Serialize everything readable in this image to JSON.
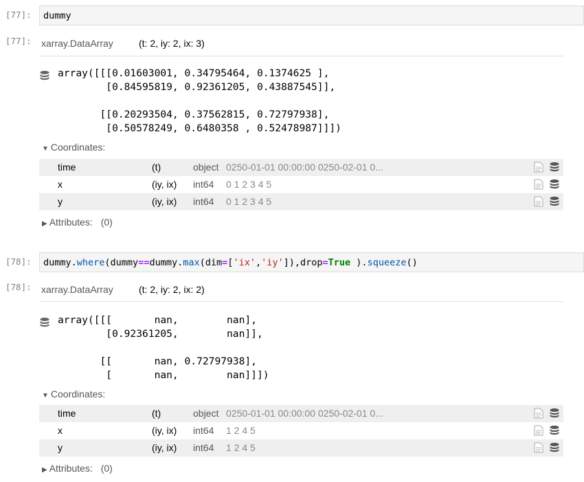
{
  "cells": [
    {
      "input_prompt": "[77]:",
      "output_prompt": "[77]:",
      "code_plain": "dummy",
      "output": {
        "type_label": "xarray.DataArray",
        "dims_label": "(t: 2, iy: 2, ix: 3)",
        "array_text": "array([[[0.01603001, 0.34795464, 0.1374625 ],\n        [0.84595819, 0.92361205, 0.43887545]],\n\n       [[0.20293504, 0.37562815, 0.72797938],\n        [0.50578249, 0.6480358 , 0.52478987]]])",
        "coordinates_label": "Coordinates:",
        "coords": [
          {
            "name": "time",
            "dims": "(t)",
            "dtype": "object",
            "preview": "0250-01-01 00:00:00 0250-02-01 0..."
          },
          {
            "name": "x",
            "dims": "(iy, ix)",
            "dtype": "int64",
            "preview": "0 1 2 3 4 5"
          },
          {
            "name": "y",
            "dims": "(iy, ix)",
            "dtype": "int64",
            "preview": "0 1 2 3 4 5"
          }
        ],
        "attributes_label": "Attributes:",
        "attributes_count": "(0)"
      }
    },
    {
      "input_prompt": "[78]:",
      "output_prompt": "[78]:",
      "code_tokens": {
        "t1": "dummy.",
        "t2": "where",
        "t3": "(dummy",
        "t4": "==",
        "t5": "dummy.",
        "t6": "max",
        "t7": "(dim",
        "t8": "=",
        "t9": "[",
        "t10": "'ix'",
        "t11": ",",
        "t12": "'iy'",
        "t13": "]),drop",
        "t14": "=",
        "t15": "True",
        "t16": " ).",
        "t17": "squeeze",
        "t18": "()"
      },
      "output": {
        "type_label": "xarray.DataArray",
        "dims_label": "(t: 2, iy: 2, ix: 2)",
        "array_text": "array([[[       nan,        nan],\n        [0.92361205,        nan]],\n\n       [[       nan, 0.72797938],\n        [       nan,        nan]]])",
        "coordinates_label": "Coordinates:",
        "coords": [
          {
            "name": "time",
            "dims": "(t)",
            "dtype": "object",
            "preview": "0250-01-01 00:00:00 0250-02-01 0..."
          },
          {
            "name": "x",
            "dims": "(iy, ix)",
            "dtype": "int64",
            "preview": "1 2 4 5"
          },
          {
            "name": "y",
            "dims": "(iy, ix)",
            "dtype": "int64",
            "preview": "1 2 4 5"
          }
        ],
        "attributes_label": "Attributes:",
        "attributes_count": "(0)"
      }
    }
  ],
  "icons": {
    "data_repr": "database-icon",
    "attrs": "file-text-icon",
    "expand": "triangle-right-icon",
    "collapse": "triangle-down-icon"
  },
  "colors": {
    "prompt": "#7f7f7f",
    "method": "#0055aa",
    "operator": "#aa22ff",
    "string": "#ba2121",
    "keyword": "#008000",
    "row_shade": "#efefef"
  }
}
